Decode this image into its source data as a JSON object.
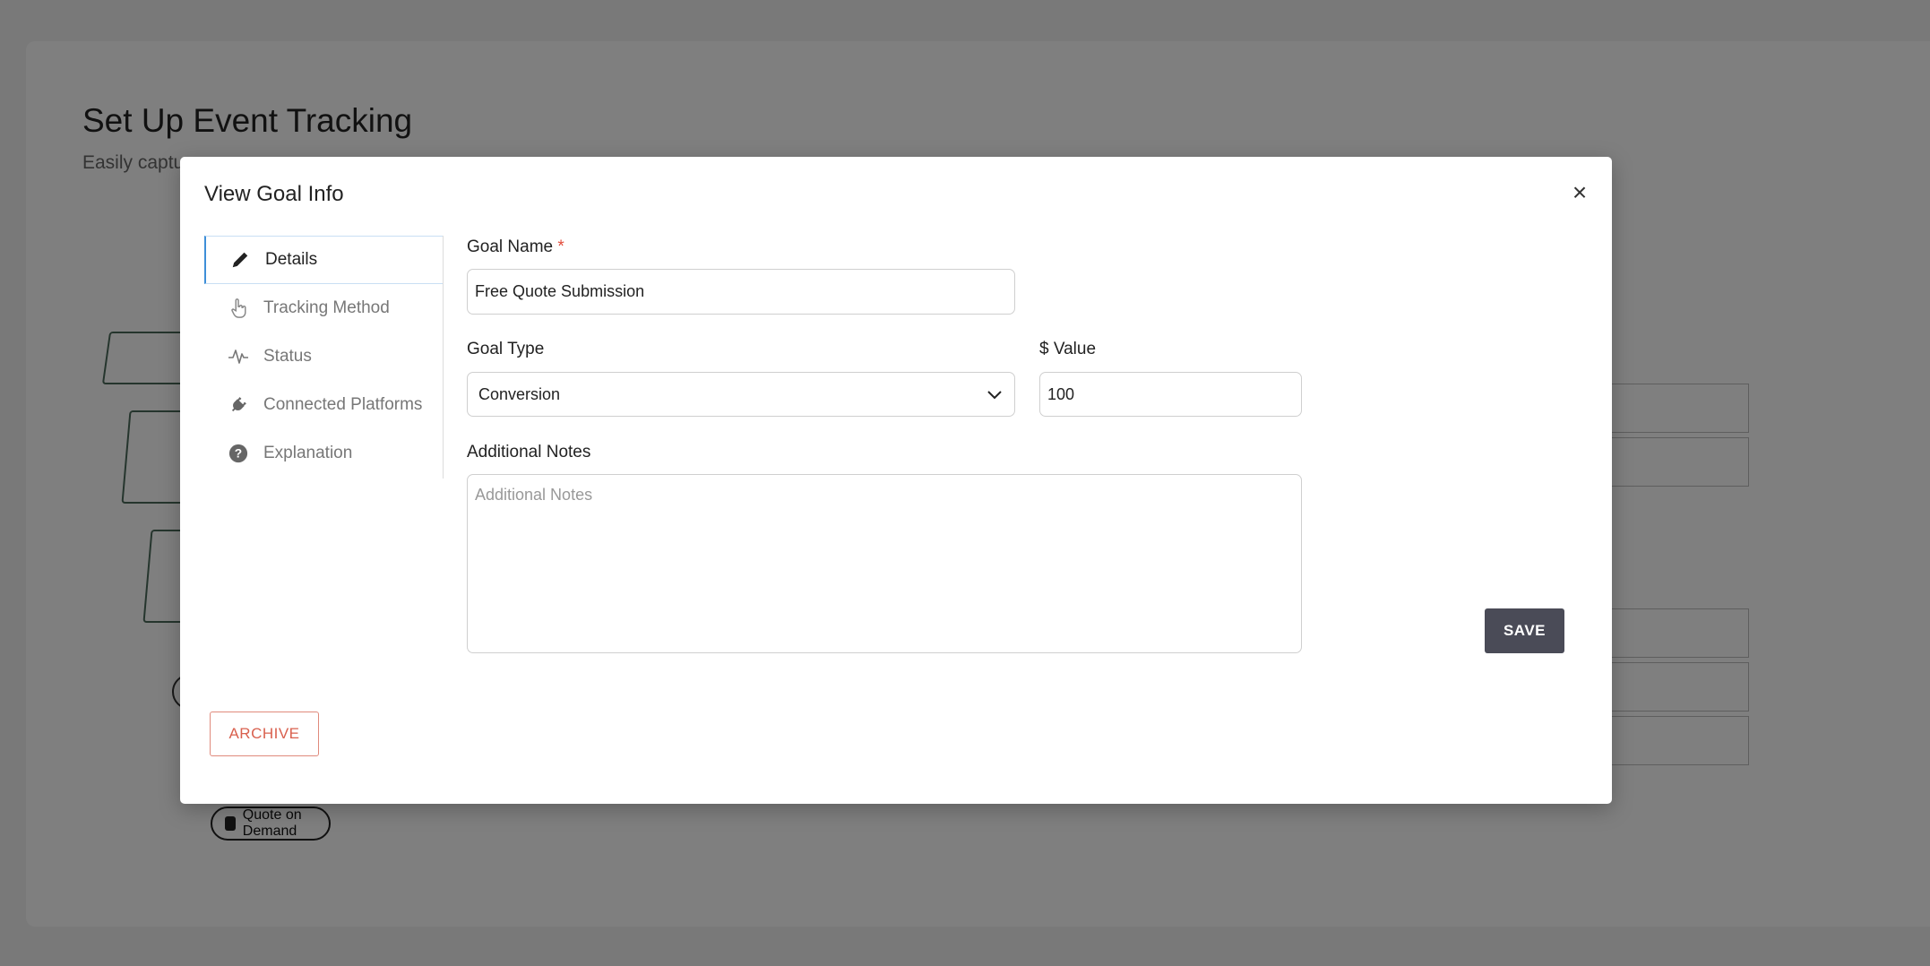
{
  "background": {
    "title": "Set Up Event Tracking",
    "subtitle": "Easily captu",
    "pill_label": "Quote on Demand"
  },
  "modal": {
    "title": "View Goal Info",
    "close_symbol": "×",
    "nav": [
      {
        "label": "Details",
        "icon": "pencil-icon",
        "active": true
      },
      {
        "label": "Tracking Method",
        "icon": "hand-pointer-icon",
        "active": false
      },
      {
        "label": "Status",
        "icon": "pulse-icon",
        "active": false
      },
      {
        "label": "Connected Platforms",
        "icon": "plug-icon",
        "active": false
      },
      {
        "label": "Explanation",
        "icon": "question-circle-icon",
        "active": false
      }
    ],
    "form": {
      "goal_name_label": "Goal Name",
      "required_mark": "*",
      "goal_name_value": "Free Quote Submission",
      "goal_type_label": "Goal Type",
      "goal_type_value": "Conversion",
      "value_label": "$ Value",
      "value_value": "100",
      "notes_label": "Additional Notes",
      "notes_placeholder": "Additional Notes"
    },
    "save_label": "SAVE",
    "archive_label": "ARCHIVE"
  },
  "colors": {
    "accent": "#3e8fd8",
    "save_bg": "#4a4b57",
    "archive_text": "#d9604e",
    "required": "#e24c3c"
  }
}
